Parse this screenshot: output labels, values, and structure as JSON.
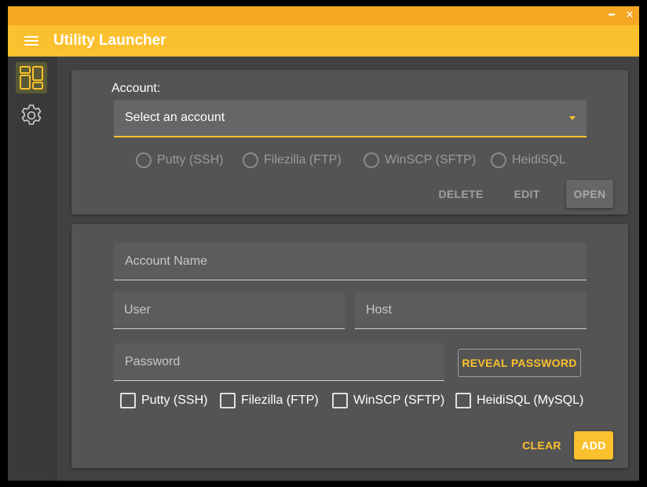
{
  "window": {
    "minimize_glyph": "━",
    "close_glyph": "✕"
  },
  "appbar": {
    "title": "Utility Launcher",
    "menu_icon": "hamburger-icon"
  },
  "sidebar": {
    "items": [
      {
        "icon": "dashboard-icon",
        "active": true
      },
      {
        "icon": "gear-icon",
        "active": false
      }
    ]
  },
  "account_card": {
    "label": "Account:",
    "select": {
      "value": "Select an account"
    },
    "radios": [
      {
        "label": "Putty (SSH)",
        "checked": false
      },
      {
        "label": "Filezilla (FTP)",
        "checked": false
      },
      {
        "label": "WinSCP (SFTP)",
        "checked": false
      },
      {
        "label": "HeidiSQL",
        "checked": false
      }
    ],
    "buttons": {
      "delete": "DELETE",
      "edit": "EDIT",
      "open": "OPEN"
    }
  },
  "form_card": {
    "account_name": {
      "placeholder": "Account Name",
      "value": ""
    },
    "user": {
      "placeholder": "User",
      "value": ""
    },
    "host": {
      "placeholder": "Host",
      "value": ""
    },
    "password": {
      "placeholder": "Password",
      "value": ""
    },
    "reveal_password": "REVEAL PASSWORD",
    "checkboxes": [
      {
        "label": "Putty (SSH)",
        "checked": false
      },
      {
        "label": "Filezilla (FTP)",
        "checked": false
      },
      {
        "label": "WinSCP (SFTP)",
        "checked": false
      },
      {
        "label": "HeidiSQL (MySQL)",
        "checked": false
      }
    ],
    "buttons": {
      "clear": "CLEAR",
      "add": "ADD"
    }
  },
  "colors": {
    "accent": "#fbc02d",
    "titlebar": "#f5a623",
    "background": "#424242",
    "card": "#545454"
  }
}
